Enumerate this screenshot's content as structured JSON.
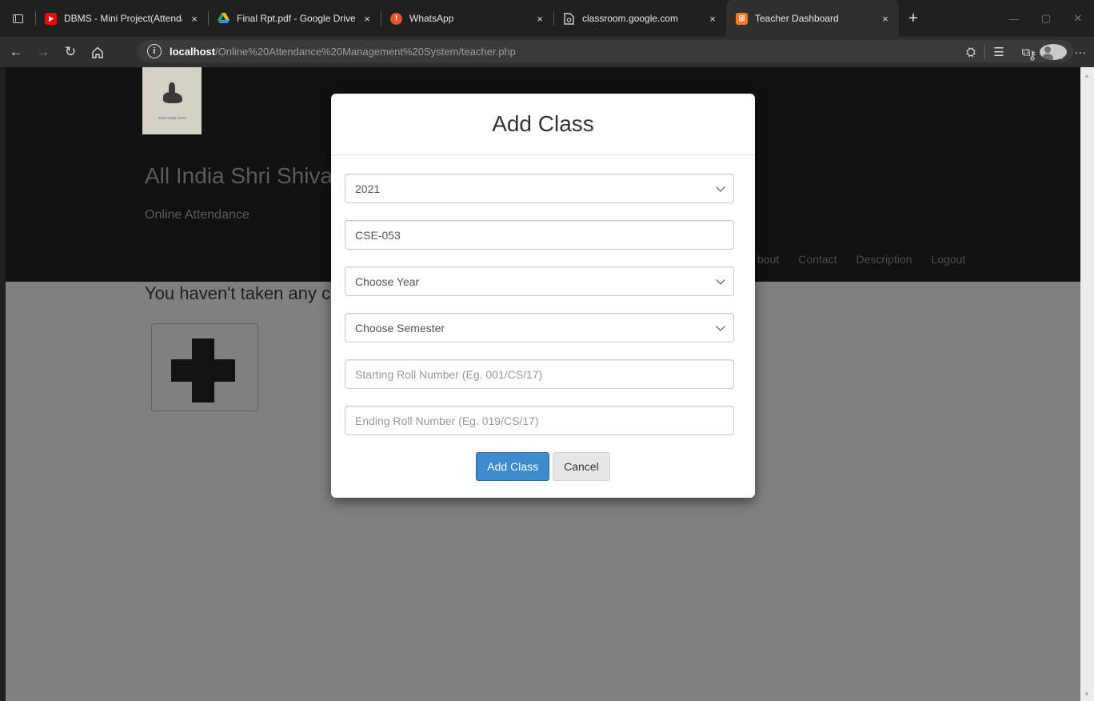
{
  "browser": {
    "tabs": [
      {
        "title": "DBMS - Mini Project(Attendance",
        "favicon": "youtube-icon",
        "color": "#ff0000",
        "active": false
      },
      {
        "title": "Final Rpt.pdf - Google Drive",
        "favicon": "google-drive-icon",
        "color": "#1fa463",
        "active": false
      },
      {
        "title": "WhatsApp",
        "favicon": "whatsapp-icon",
        "color": "#e8542f",
        "active": false
      },
      {
        "title": "classroom.google.com",
        "favicon": "page-icon",
        "color": "#cfcfcf",
        "active": false
      },
      {
        "title": "Teacher Dashboard",
        "favicon": "xampp-icon",
        "color": "#fb7a24",
        "active": true
      }
    ],
    "new_tab": "+",
    "close_glyph": "×",
    "url_host": "localhost",
    "url_path": "/Online%20Attendance%20Management%20System/teacher.php"
  },
  "site": {
    "logo_motto": "जगदम्ब जगदम्ब जगदम्ब",
    "title": "All India Shri Shivaji M",
    "subtitle": "Online Attendance",
    "nav": [
      "bout",
      "Contact",
      "Description",
      "Logout"
    ],
    "empty_message": "You haven't taken any cl"
  },
  "modal": {
    "title": "Add Class",
    "session_value": "2021",
    "course_value": "CSE-053",
    "year_placeholder": "Choose Year",
    "semester_placeholder": "Choose Semester",
    "start_roll_placeholder": "Starting Roll Number (Eg. 001/CS/17)",
    "end_roll_placeholder": "Ending Roll Number (Eg. 019/CS/17)",
    "add_button": "Add Class",
    "cancel_button": "Cancel"
  },
  "colors": {
    "primary": "#3d8bcd",
    "header_bg": "#111111",
    "overlay": "#808080"
  }
}
